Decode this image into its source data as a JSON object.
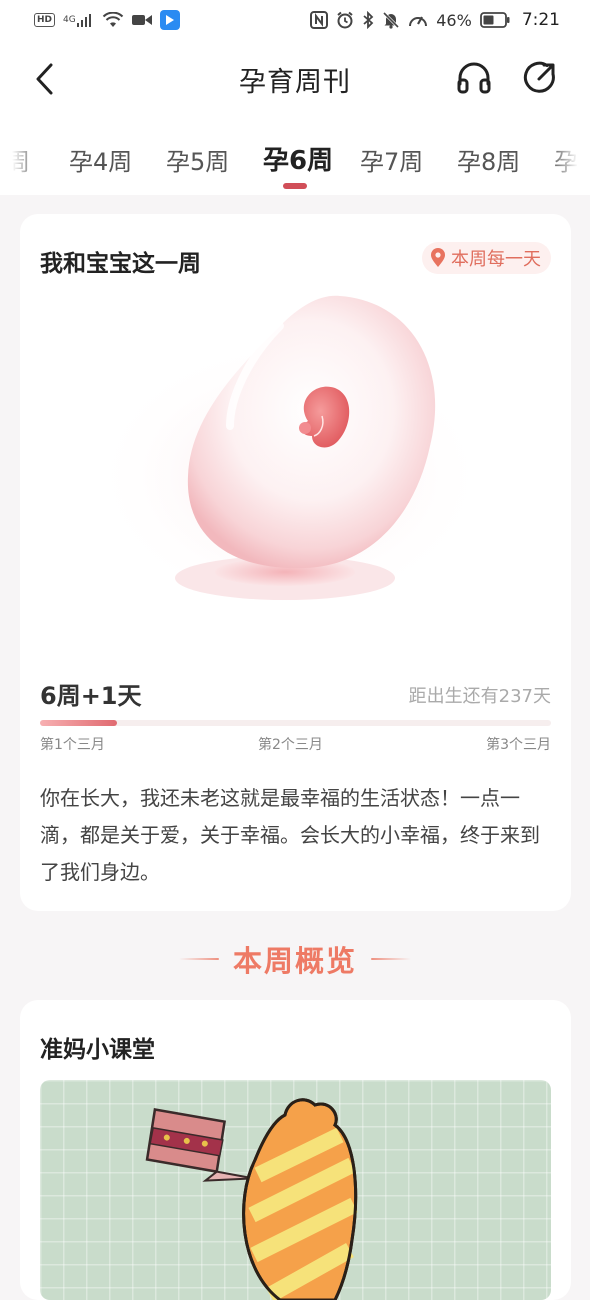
{
  "status_bar": {
    "hd": "HD",
    "network": "4G",
    "battery_percent": "46%",
    "time": "7:21",
    "icons": [
      "hd-icon",
      "signal-icon",
      "wifi-icon",
      "video-icon",
      "app-icon",
      "nfc-icon",
      "alarm-icon",
      "bluetooth-icon",
      "mute-icon",
      "speed-icon",
      "battery-icon"
    ]
  },
  "header": {
    "title": "孕育周刊",
    "icons": [
      "back-icon",
      "headphones-icon",
      "share-icon"
    ]
  },
  "tabs": {
    "partial_left": "周",
    "items": [
      "孕4周",
      "孕5周",
      "孕6周",
      "孕7周",
      "孕8周"
    ],
    "partial_right": "孕",
    "active_index": 2
  },
  "weekly_card": {
    "title": "我和宝宝这一周",
    "location_badge": "本周每一天",
    "week_day": "6周+1天",
    "days_left": "距出生还有237天",
    "progress_fraction": 0.15,
    "trimesters": [
      "第1个三月",
      "第2个三月",
      "第3个三月"
    ],
    "description": "你在长大，我还未老这就是最幸福的生活状态！一点一滴，都是关于爱，关于幸福。会长大的小幸福，终于来到了我们身边。"
  },
  "overview": {
    "title": "本周概览"
  },
  "class_card": {
    "title": "准妈小课堂"
  },
  "colors": {
    "accent": "#d14e58",
    "section_title": "#ee7a65",
    "badge_text": "#e06e5e",
    "badge_bg": "#fdf0ef",
    "thumb_bg": "#c9dccb"
  }
}
